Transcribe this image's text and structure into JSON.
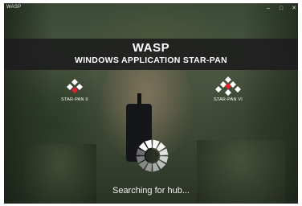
{
  "window": {
    "app_name": "WASP",
    "controls": {
      "minimize": "–",
      "maximize": "□",
      "close": "✕"
    }
  },
  "banner": {
    "title": "WASP",
    "subtitle": "WINDOWS APPLICATION STAR-PAN"
  },
  "devices": [
    {
      "label": "STAR-PAN II",
      "icon": "star-pan-ii-icon"
    },
    {
      "label": "STAR-PAN VI",
      "icon": "star-pan-vi-icon"
    }
  ],
  "status": {
    "text": "Searching for hub...",
    "indicator": "busy-spinner-icon"
  },
  "colors": {
    "accent": "#e0232a",
    "text": "#ffffff",
    "banner_bg": "#1c1c1e"
  }
}
